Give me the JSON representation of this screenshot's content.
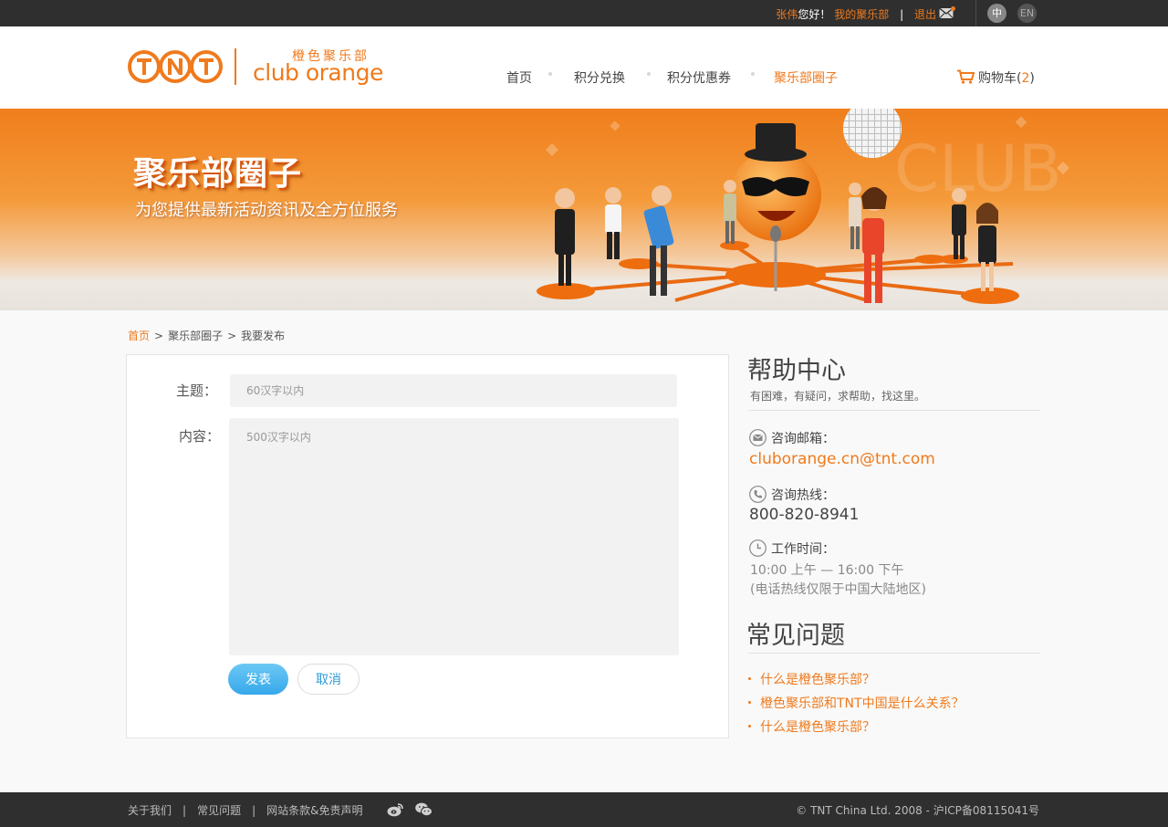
{
  "topbar": {
    "user_name": "张伟",
    "greeting": "您好！",
    "my_club": "我的聚乐部",
    "separator": "|",
    "logout": "退出",
    "lang_zh": "中",
    "lang_en": "EN"
  },
  "brand": {
    "logo_text": "TNT",
    "club_cn": "橙色聚乐部",
    "club_en": "club orange"
  },
  "nav": {
    "items": [
      {
        "label": "首页"
      },
      {
        "label": "积分兑换"
      },
      {
        "label": "积分优惠券"
      },
      {
        "label": "聚乐部圈子"
      }
    ],
    "active": "聚乐部圈子"
  },
  "cart": {
    "label": "购物车",
    "count": "2"
  },
  "banner": {
    "title": "聚乐部圈子",
    "subtitle": "为您提供最新活动资讯及全方位服务",
    "bg_text": "CLUB"
  },
  "breadcrumb": {
    "items": [
      "首页",
      "聚乐部圈子",
      "我要发布"
    ],
    "separator": ">"
  },
  "form": {
    "subject_label": "主题：",
    "subject_placeholder": "60汉字以内",
    "content_label": "内容：",
    "content_placeholder": "500汉字以内",
    "submit": "发表",
    "cancel": "取消"
  },
  "help": {
    "title": "帮助中心",
    "subtitle": "有困难，有疑问，求帮助，找这里。",
    "email_label": "咨询邮箱：",
    "email": "cluborange.cn@tnt.com",
    "phone_label": "咨询热线：",
    "phone": "800-820-8941",
    "hours_label": "工作时间：",
    "hours": "10:00 上午  — 16:00 下午",
    "hours_note": "(电话热线仅限于中国大陆地区)"
  },
  "faq": {
    "title": "常见问题",
    "items": [
      {
        "label": "什么是橙色聚乐部？"
      },
      {
        "label": "橙色聚乐部和TNT中国是什么关系？"
      },
      {
        "label": "什么是橙色聚乐部？"
      }
    ]
  },
  "footer": {
    "links": [
      "关于我们",
      "常见问题",
      "网站条款&免责声明"
    ],
    "separator": "|",
    "copyright": "© TNT China Ltd. 2008 - 沪ICP备08115041号"
  },
  "colors": {
    "brand_orange": "#f07a1c",
    "dark_bar": "#2f2f2f",
    "button_blue": "#36a8ea"
  }
}
